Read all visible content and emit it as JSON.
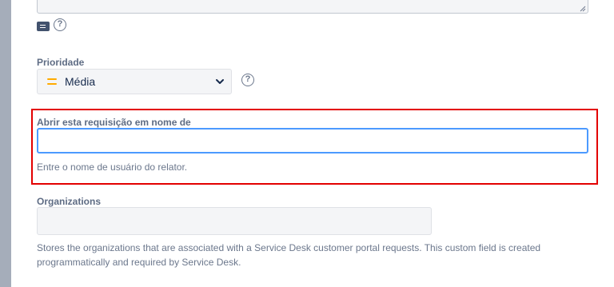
{
  "description_field": {
    "help_glyph": "?"
  },
  "priority": {
    "label": "Prioridade",
    "selected": "Média",
    "icon": "priority-medium-icon",
    "icon_color": "#ffab00",
    "help_glyph": "?"
  },
  "on_behalf": {
    "label": "Abrir esta requisição em nome de",
    "value": "",
    "help": "Entre o nome de usuário do relator.",
    "highlight_color": "#e30000",
    "focus_color": "#4c9aff"
  },
  "organizations": {
    "label": "Organizations",
    "value": "",
    "help": "Stores the organizations that are associated with a Service Desk customer portal requests. This custom field is created programmatically and required by Service Desk."
  }
}
